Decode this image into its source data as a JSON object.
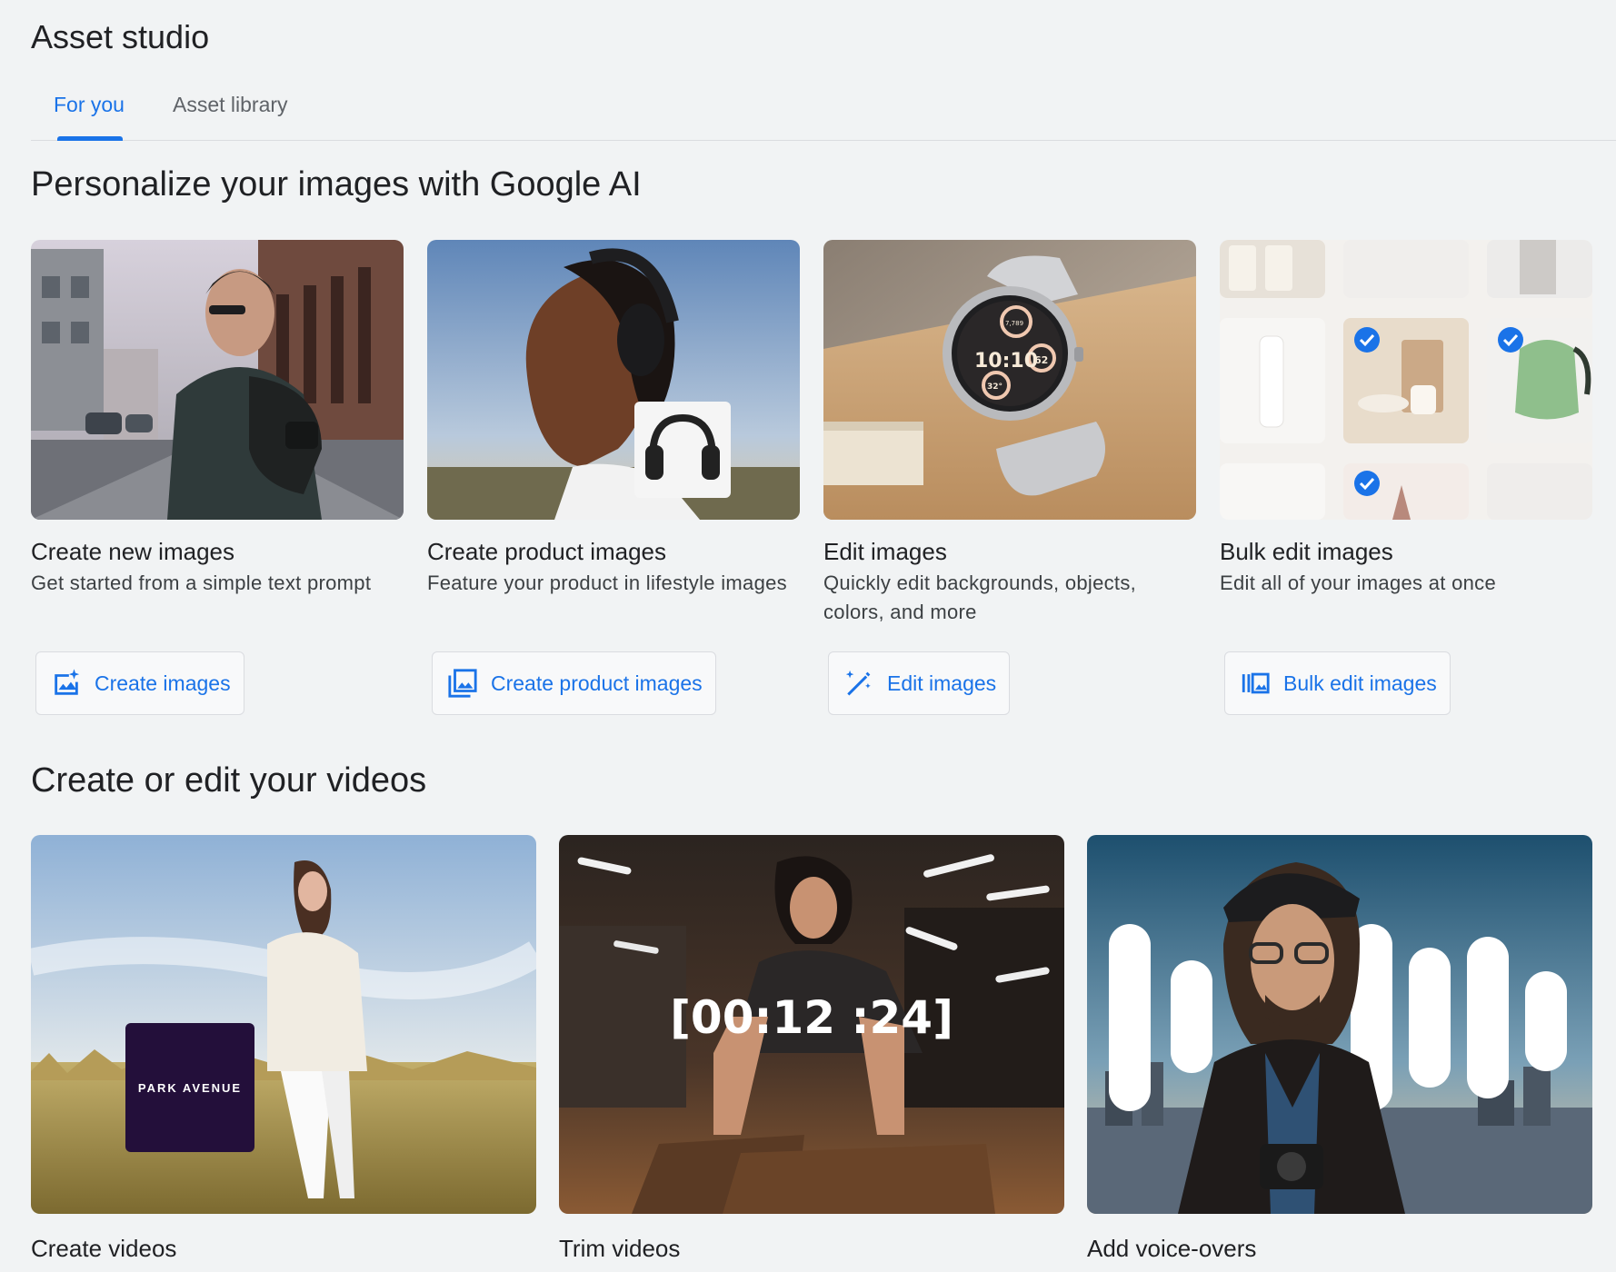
{
  "app": {
    "title": "Asset studio"
  },
  "tabs": [
    {
      "label": "For you",
      "active": true
    },
    {
      "label": "Asset library",
      "active": false
    }
  ],
  "images_section": {
    "title": "Personalize your images with Google AI",
    "cards": [
      {
        "title": "Create new images",
        "description": "Get started from a simple text prompt",
        "button": "Create images",
        "icon": "image-sparkle-icon"
      },
      {
        "title": "Create product images",
        "description": "Feature your product in lifestyle images",
        "button": "Create product images",
        "icon": "image-stack-icon"
      },
      {
        "title": "Edit images",
        "description": "Quickly edit backgrounds, objects, colors, and more",
        "button": "Edit images",
        "icon": "magic-wand-icon"
      },
      {
        "title": "Bulk edit images",
        "description": "Edit all of your images at once",
        "button": "Bulk edit images",
        "icon": "bulk-images-icon"
      }
    ]
  },
  "videos_section": {
    "title": "Create or edit your videos",
    "cards": [
      {
        "title": "Create videos",
        "overlay_text": "PARK AVENUE"
      },
      {
        "title": "Trim videos",
        "overlay_text": "[00:12 :24]"
      },
      {
        "title": "Add voice-overs"
      }
    ]
  },
  "watch": {
    "time": "10:10",
    "dial_a": "62",
    "dial_b": "32°",
    "steps": "7,789"
  },
  "colors": {
    "accent": "#1a73e8",
    "background": "#f1f3f4",
    "text": "#202124",
    "border": "#dadce0"
  }
}
